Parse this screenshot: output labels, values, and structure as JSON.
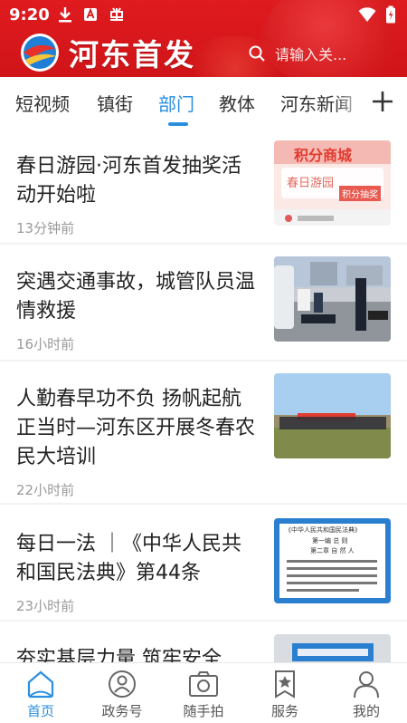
{
  "status_bar": {
    "time": "9:20"
  },
  "header": {
    "brand": "河东首发",
    "search_placeholder": "请输入关..."
  },
  "tabs": [
    {
      "label": "短视频"
    },
    {
      "label": "镇街"
    },
    {
      "label": "部门",
      "active": true
    },
    {
      "label": "教体"
    },
    {
      "label": "河东新闻"
    }
  ],
  "articles": [
    {
      "title": "春日游园·河东首发抽奖活动开始啦",
      "time": "13分钟前",
      "thumb_text_1": "积分商城",
      "thumb_text_2": "春日游园",
      "thumb_text_3": "积分抽奖"
    },
    {
      "title": "突遇交通事故，城管队员温情救援",
      "time": "16小时前"
    },
    {
      "title": "人勤春早功不负  扬帆起航正当时—河东区开展冬春农民大培训",
      "time": "22小时前"
    },
    {
      "title": "每日一法 ｜《中华人民共和国民法典》第44条",
      "time": "23小时前",
      "thumb_text_1": "《中华人民共和国民法典》",
      "thumb_text_2": "第一编 总 则",
      "thumb_text_3": "第二章 自 然 人"
    },
    {
      "title": "夯实基层力量 筑牢安全"
    }
  ],
  "bottom_nav": [
    {
      "label": "首页",
      "icon": "home-icon",
      "active": true
    },
    {
      "label": "政务号",
      "icon": "gov-account-icon"
    },
    {
      "label": "随手拍",
      "icon": "camera-icon"
    },
    {
      "label": "服务",
      "icon": "service-icon"
    },
    {
      "label": "我的",
      "icon": "user-icon"
    }
  ],
  "colors": {
    "header_red": "#d8181c",
    "accent_blue": "#2b8fe0"
  }
}
